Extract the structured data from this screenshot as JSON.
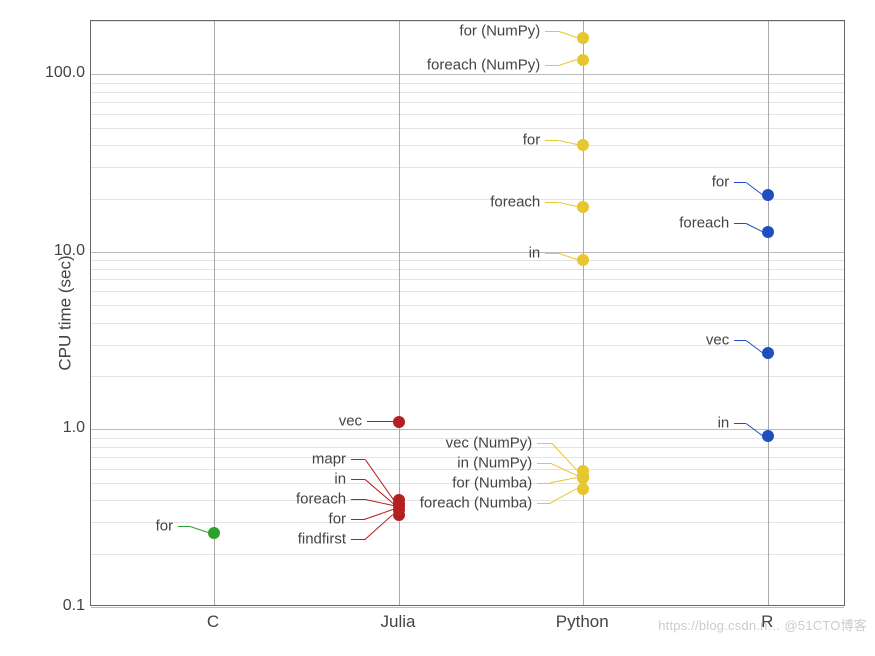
{
  "chart_data": {
    "type": "scatter",
    "title": "",
    "xlabel": "",
    "ylabel": "CPU time (sec)",
    "ylim": [
      0.1,
      200
    ],
    "yscale": "log",
    "yticks": [
      0.1,
      1.0,
      10.0,
      100.0
    ],
    "ytick_labels": [
      "0.1",
      "1.0",
      "10.0",
      "100.0"
    ],
    "categories": [
      "C",
      "Julia",
      "Python",
      "R"
    ],
    "colors": {
      "C": "#2ca02c",
      "Julia": "#b22020",
      "Python": "#e7c72f",
      "R": "#1f4fbf"
    },
    "points": [
      {
        "lang": "C",
        "label": "for",
        "value": 0.26
      },
      {
        "lang": "Julia",
        "label": "vec",
        "value": 1.1
      },
      {
        "lang": "Julia",
        "label": "mapr",
        "value": 0.4
      },
      {
        "lang": "Julia",
        "label": "in",
        "value": 0.38
      },
      {
        "lang": "Julia",
        "label": "foreach",
        "value": 0.37
      },
      {
        "lang": "Julia",
        "label": "for",
        "value": 0.35
      },
      {
        "lang": "Julia",
        "label": "findfirst",
        "value": 0.33
      },
      {
        "lang": "Python",
        "label": "for (NumPy)",
        "value": 160
      },
      {
        "lang": "Python",
        "label": "foreach (NumPy)",
        "value": 120
      },
      {
        "lang": "Python",
        "label": "for",
        "value": 40
      },
      {
        "lang": "Python",
        "label": "foreach",
        "value": 18
      },
      {
        "lang": "Python",
        "label": "in",
        "value": 9.0
      },
      {
        "lang": "Python",
        "label": "vec (NumPy)",
        "value": 0.58
      },
      {
        "lang": "Python",
        "label": "in (NumPy)",
        "value": 0.55
      },
      {
        "lang": "Python",
        "label": "for (Numba)",
        "value": 0.53
      },
      {
        "lang": "Python",
        "label": "foreach (Numba)",
        "value": 0.46
      },
      {
        "lang": "R",
        "label": "for",
        "value": 21
      },
      {
        "lang": "R",
        "label": "foreach",
        "value": 13
      },
      {
        "lang": "R",
        "label": "vec",
        "value": 2.7
      },
      {
        "lang": "R",
        "label": "in",
        "value": 0.92
      }
    ]
  },
  "watermark": "https://blog.csdn.n… @51CTO博客"
}
